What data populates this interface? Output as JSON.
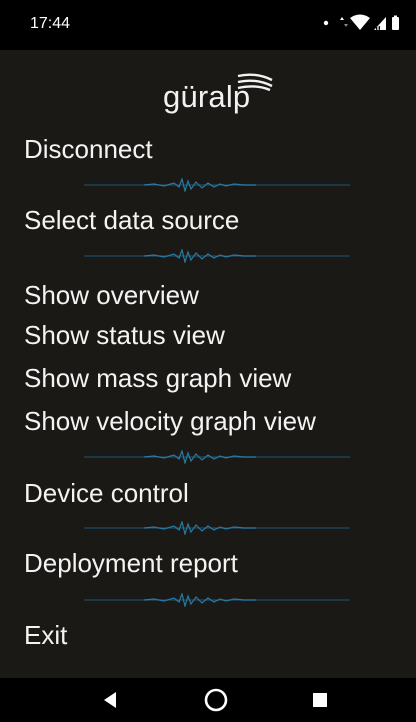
{
  "status_bar": {
    "time": "17:44",
    "icons": [
      "dot-icon",
      "data-arrows-icon",
      "wifi-icon",
      "cellular-signal-icon",
      "battery-icon"
    ]
  },
  "app": {
    "logo_text": "güralp"
  },
  "menu": {
    "disconnect": "Disconnect",
    "select_data_source": "Select data source",
    "show_overview": "Show overview",
    "show_status_view": "Show status view",
    "show_mass_graph_view": "Show mass graph view",
    "show_velocity_graph_view": "Show velocity graph view",
    "device_control": "Device control",
    "deployment_report": "Deployment report",
    "exit": "Exit"
  },
  "colors": {
    "background": "#1b1915",
    "text": "#f3f3f3",
    "divider_line": "#1d4a63",
    "divider_wave": "#2a7aa3"
  },
  "nav_bar": {
    "buttons": [
      "back-icon",
      "home-icon",
      "recents-icon"
    ]
  }
}
